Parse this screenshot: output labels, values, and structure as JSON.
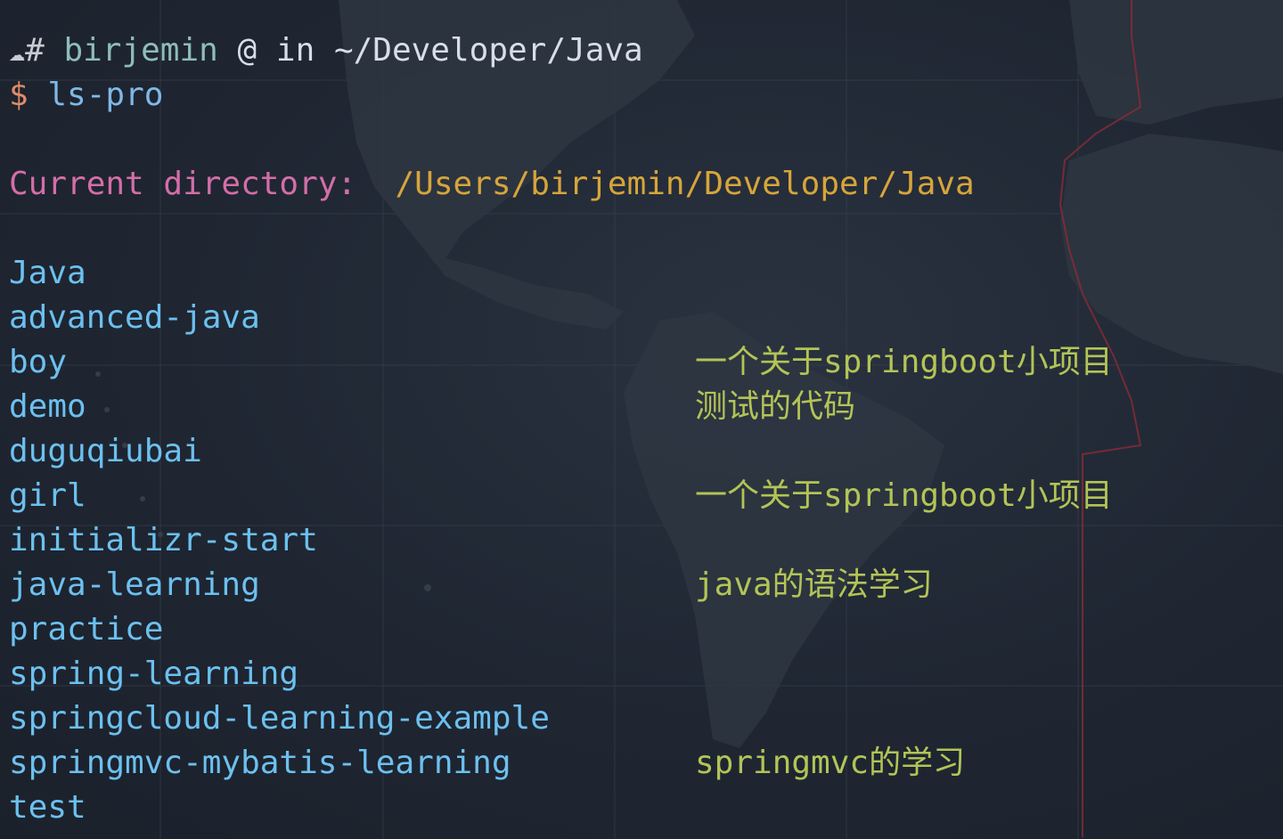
{
  "prompt": {
    "cloud_icon": "cloud-icon",
    "hash": "#",
    "user": "birjemin",
    "at": "@",
    "in": "in",
    "path": "~/Developer/Java"
  },
  "command": {
    "dollar": "$",
    "text": "ls-pro"
  },
  "current_dir": {
    "label": "Current directory:",
    "path": "/Users/birjemin/Developer/Java"
  },
  "entries": [
    {
      "name": "Java",
      "note": ""
    },
    {
      "name": "advanced-java",
      "note": ""
    },
    {
      "name": "boy",
      "note": "一个关于springboot小项目"
    },
    {
      "name": "demo",
      "note": "测试的代码"
    },
    {
      "name": "duguqiubai",
      "note": ""
    },
    {
      "name": "girl",
      "note": "一个关于springboot小项目"
    },
    {
      "name": "initializr-start",
      "note": ""
    },
    {
      "name": "java-learning",
      "note": "java的语法学习"
    },
    {
      "name": "practice",
      "note": ""
    },
    {
      "name": "spring-learning",
      "note": ""
    },
    {
      "name": "springcloud-learning-example",
      "note": ""
    },
    {
      "name": "springmvc-mybatis-learning",
      "note": "springmvc的学习"
    },
    {
      "name": "test",
      "note": ""
    }
  ],
  "colors": {
    "background": "#1f2632",
    "prompt_user": "#8fbcbb",
    "dollar": "#e08b6a",
    "command": "#7fb8e6",
    "label_pink": "#d46ea8",
    "label_gold": "#d6a53a",
    "entry_name": "#6cc0ef",
    "entry_note": "#b3c456"
  }
}
